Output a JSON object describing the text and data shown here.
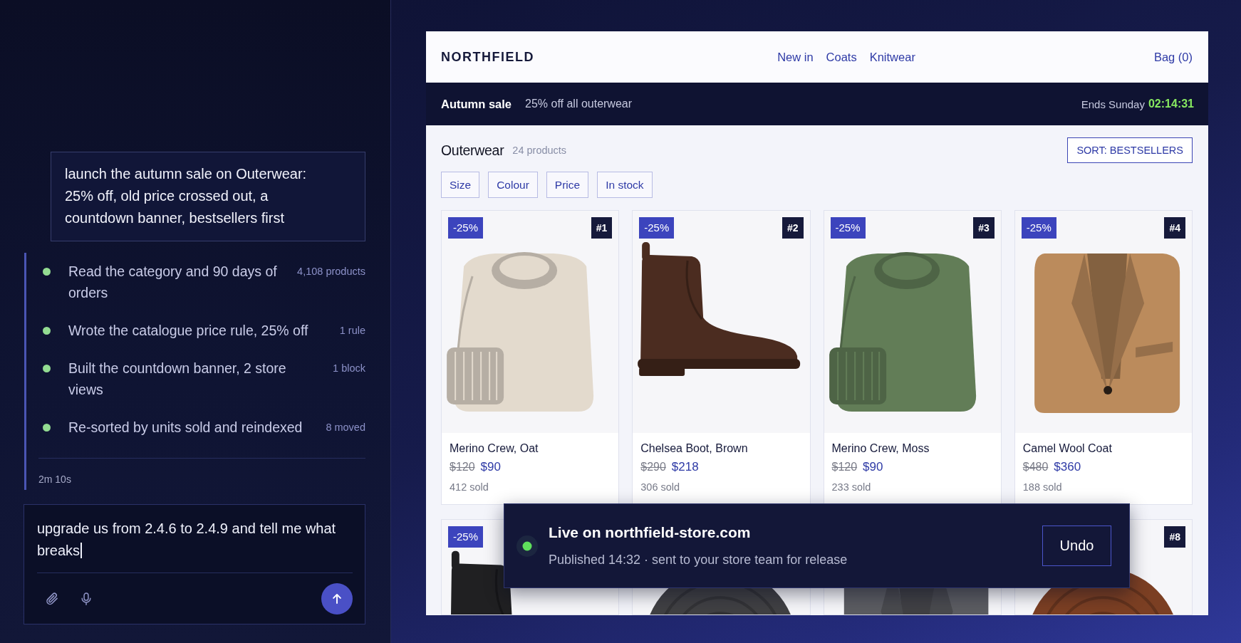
{
  "agent_panel": {
    "prompt": "launch the autumn sale on Outerwear: 25% off, old price crossed out, a countdown banner, bestsellers first",
    "steps": [
      {
        "text": "Read the category and 90 days of orders",
        "meta": "4,108 products",
        "done": true
      },
      {
        "text": "Wrote the catalogue price rule, 25% off",
        "meta": "1 rule",
        "done": true
      },
      {
        "text": "Built the countdown banner, 2 store views",
        "meta": "1 block",
        "done": true
      },
      {
        "text": "Re-sorted by units sold and reindexed",
        "meta": "8 moved",
        "done": true
      }
    ],
    "elapsed": "2m 10s",
    "composer": {
      "value": "upgrade us from 2.4.6 to 2.4.9 and tell me what breaks"
    }
  },
  "store_preview": {
    "brand": "NORTHFIELD",
    "nav": [
      "New in",
      "Coats",
      "Knitwear"
    ],
    "bag": "Bag (0)",
    "sale_banner": {
      "title": "Autumn sale",
      "text": "25% off all outerwear",
      "ends_label": "Ends Sunday",
      "countdown": "02:14:31"
    },
    "category": {
      "title": "Outerwear",
      "count": "24 products",
      "sort": "SORT: BESTSELLERS"
    },
    "filters": [
      "Size",
      "Colour",
      "Price",
      "In stock"
    ],
    "products": [
      {
        "kind": "sweater",
        "color": "#e3dacd",
        "discount": "-25%",
        "rank": "#1",
        "name": "Merino Crew, Oat",
        "old_price": "$120",
        "price": "$90",
        "sold": "412 sold"
      },
      {
        "kind": "boot",
        "color": "#4b2c20",
        "discount": "-25%",
        "rank": "#2",
        "name": "Chelsea Boot, Brown",
        "old_price": "$290",
        "price": "$218",
        "sold": "306 sold"
      },
      {
        "kind": "sweater",
        "color": "#627d57",
        "discount": "-25%",
        "rank": "#3",
        "name": "Merino Crew, Moss",
        "old_price": "$120",
        "price": "$90",
        "sold": "233 sold"
      },
      {
        "kind": "coat",
        "color": "#bb8b5c",
        "discount": "-25%",
        "rank": "#4",
        "name": "Camel Wool Coat",
        "old_price": "$480",
        "price": "$360",
        "sold": "188 sold"
      },
      {
        "kind": "boot",
        "color": "#202022",
        "discount": "-25%"
      },
      {
        "kind": "scarf",
        "color": "#404043"
      },
      {
        "kind": "coat",
        "color": "#5b5c61"
      },
      {
        "kind": "scarf",
        "color": "#7b3f23",
        "rank": "#8"
      }
    ]
  },
  "toast": {
    "live": true,
    "title": "Live on northfield-store.com",
    "text": "Published 14:32 · sent to your store team for release",
    "action": "Undo"
  }
}
